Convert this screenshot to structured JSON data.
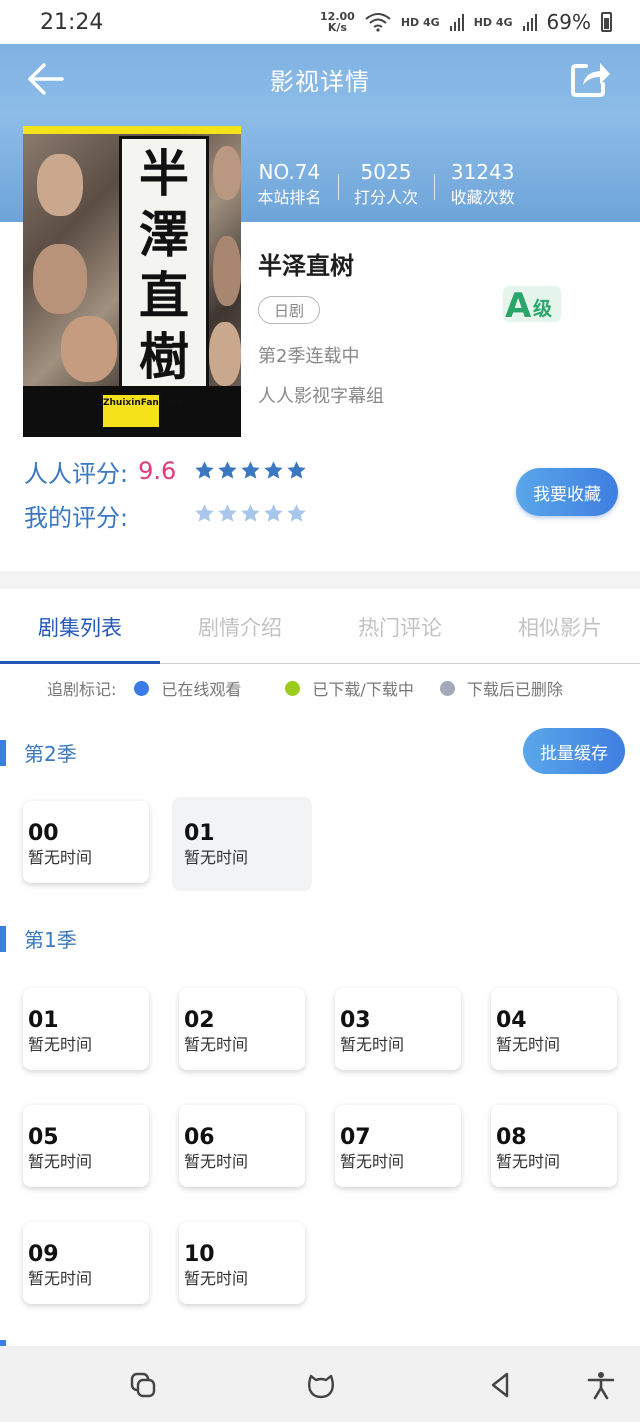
{
  "status_bar": {
    "time": "21:24",
    "speed_value": "12.00",
    "speed_unit": "K/s",
    "signal_1": "HD 4G",
    "signal_2": "HD 4G",
    "battery": "69%"
  },
  "header": {
    "title": "影视详情"
  },
  "stats": [
    {
      "value": "NO.74",
      "label": "本站排名"
    },
    {
      "value": "5025",
      "label": "打分人次"
    },
    {
      "value": "31243",
      "label": "收藏次数"
    }
  ],
  "poster": {
    "title_chars": [
      "半",
      "澤",
      "直",
      "樹"
    ],
    "logo_text": "ZhuixinFan.com"
  },
  "movie": {
    "title": "半泽直树",
    "genre": "日剧",
    "grade_letter": "A",
    "grade_suffix": "级",
    "season_status": "第2季连载中",
    "subtitle_group": "人人影视字幕组"
  },
  "ratings": {
    "site_label": "人人评分:",
    "site_score": "9.6",
    "site_stars": 5,
    "my_label": "我的评分:",
    "my_stars": 0,
    "collect_button": "我要收藏"
  },
  "tabs": [
    "剧集列表",
    "剧情介绍",
    "热门评论",
    "相似影片"
  ],
  "active_tab": 0,
  "legend": {
    "title": "追剧标记:",
    "items": [
      {
        "label": "已在线观看",
        "color": "#3a7be6"
      },
      {
        "label": "已下载/下载中",
        "color": "#9ccc1b"
      },
      {
        "label": "下载后已删除",
        "color": "#a3a9b8"
      }
    ]
  },
  "seasons": [
    {
      "title": "第2季",
      "batch_button": "批量缓存",
      "episodes": [
        {
          "num": "00",
          "time": "暂无时间"
        },
        {
          "num": "01",
          "time": "暂无时间"
        }
      ]
    },
    {
      "title": "第1季",
      "episodes": [
        {
          "num": "01",
          "time": "暂无时间"
        },
        {
          "num": "02",
          "time": "暂无时间"
        },
        {
          "num": "03",
          "time": "暂无时间"
        },
        {
          "num": "04",
          "time": "暂无时间"
        },
        {
          "num": "05",
          "time": "暂无时间"
        },
        {
          "num": "06",
          "time": "暂无时间"
        },
        {
          "num": "07",
          "time": "暂无时间"
        },
        {
          "num": "08",
          "time": "暂无时间"
        },
        {
          "num": "09",
          "time": "暂无时间"
        },
        {
          "num": "10",
          "time": "暂无时间"
        }
      ]
    }
  ],
  "bottom_nav": [
    "recent-apps-icon",
    "home-icon",
    "back-triangle-icon",
    "accessibility-icon"
  ],
  "colors": {
    "accent": "#3e7ee0",
    "header_gradient": "#7fb2e3",
    "score_pink": "#e23a7d",
    "grade_green": "#2aa66a"
  }
}
